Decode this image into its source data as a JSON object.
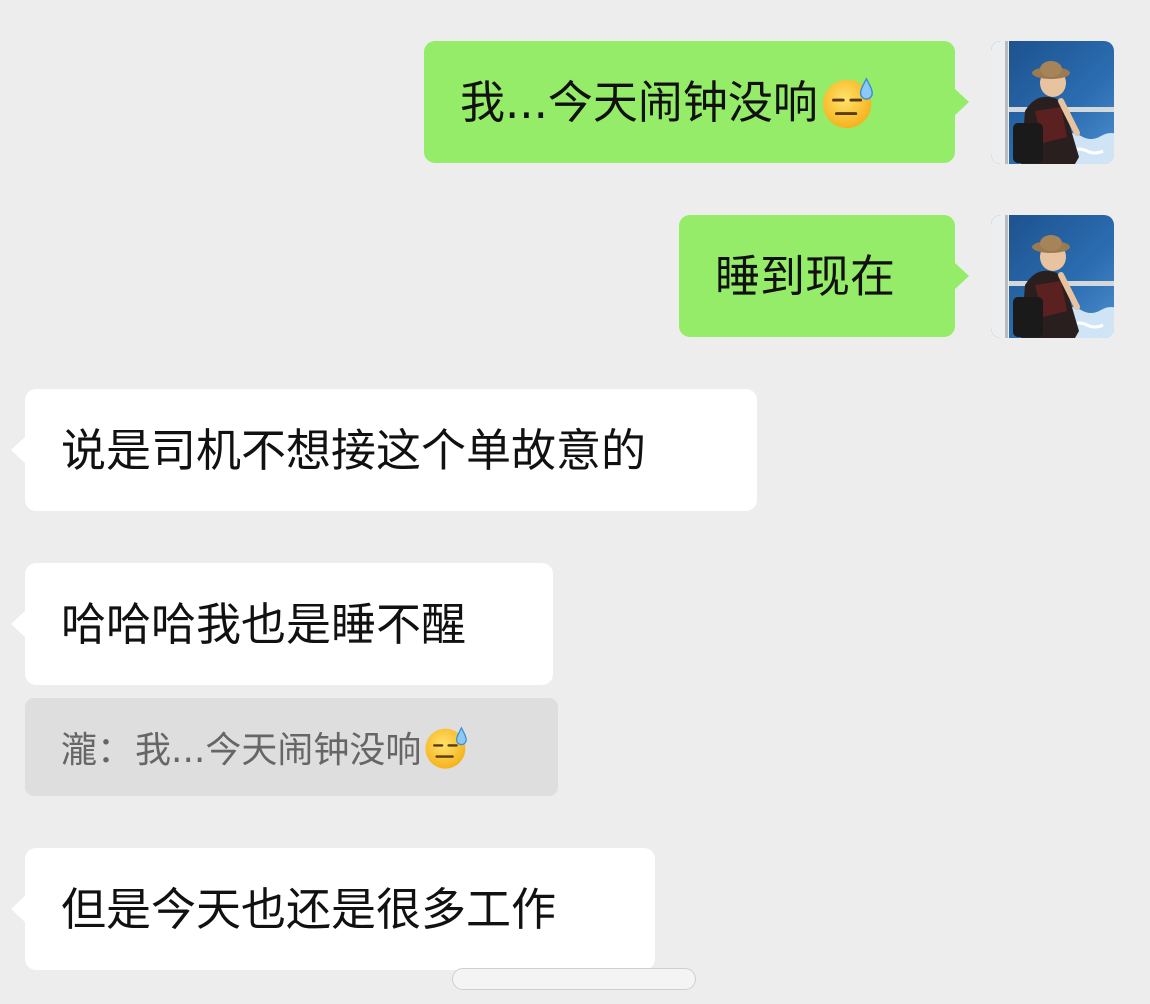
{
  "messages": [
    {
      "direction": "out",
      "text": "我...今天闹钟没响",
      "emoji": "sweat-expressionless-emoji"
    },
    {
      "direction": "out",
      "text": "睡到现在"
    },
    {
      "direction": "in",
      "text": "说是司机不想接这个单故意的"
    },
    {
      "direction": "in",
      "text": "哈哈哈我也是睡不醒",
      "quote": {
        "author": "瀧",
        "separator": "：",
        "text": "我...今天闹钟没响",
        "emoji": "sweat-expressionless-emoji"
      }
    },
    {
      "direction": "in",
      "text": "但是今天也还是很多工作"
    }
  ],
  "colors": {
    "background": "#ededed",
    "outgoing_bubble": "#95ec69",
    "incoming_bubble": "#ffffff",
    "quote_background": "#dedede"
  }
}
